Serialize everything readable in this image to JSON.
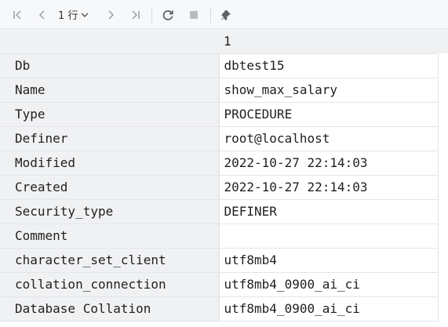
{
  "toolbar": {
    "page_label": "1 行",
    "icons": [
      "first-page-icon",
      "prev-page-icon",
      "chevron-down-icon",
      "next-page-icon",
      "last-page-icon",
      "refresh-icon",
      "stop-icon",
      "pin-icon"
    ]
  },
  "grid": {
    "column_header": "1",
    "rows": [
      {
        "key": "Db",
        "value": "dbtest15"
      },
      {
        "key": "Name",
        "value": "show_max_salary"
      },
      {
        "key": "Type",
        "value": "PROCEDURE"
      },
      {
        "key": "Definer",
        "value": "root@localhost"
      },
      {
        "key": "Modified",
        "value": "2022-10-27 22:14:03"
      },
      {
        "key": "Created",
        "value": "2022-10-27 22:14:03"
      },
      {
        "key": "Security_type",
        "value": "DEFINER"
      },
      {
        "key": "Comment",
        "value": ""
      },
      {
        "key": "character_set_client",
        "value": "utf8mb4"
      },
      {
        "key": "collation_connection",
        "value": "utf8mb4_0900_ai_ci"
      },
      {
        "key": "Database Collation",
        "value": "utf8mb4_0900_ai_ci"
      }
    ]
  }
}
